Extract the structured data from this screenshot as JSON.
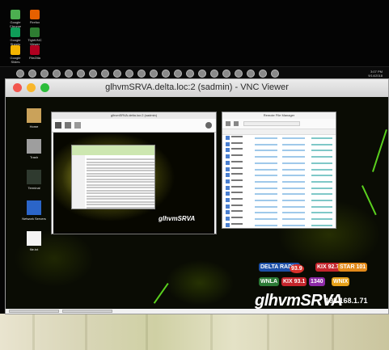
{
  "host": {
    "desktop_icons": [
      {
        "label": "Google Chrome",
        "color": "#4caf50"
      },
      {
        "label": "Firefox",
        "color": "#e66000"
      },
      {
        "label": "Google Sheets",
        "color": "#0f9d58"
      },
      {
        "label": "TightVNC Viewer",
        "color": "#2e7d32"
      },
      {
        "label": "Google Slides",
        "color": "#f4b400"
      },
      {
        "label": "FileZilla",
        "color": "#b00020"
      }
    ],
    "taskbar": {
      "item_count": 22,
      "clock": {
        "time": "3:07 PM",
        "date": "9/14/2018"
      }
    }
  },
  "vnc": {
    "title": "glhvmSRVA.delta.loc:2 (sadmin) - VNC Viewer",
    "traffic_colors": {
      "close": "#f2564e",
      "minimize": "#f8b72c",
      "zoom": "#2cbd3a"
    }
  },
  "remote": {
    "desktop_icons": [
      {
        "label": "Home",
        "color": "#caa25a"
      },
      {
        "label": "Trash",
        "color": "#9e9e9e"
      },
      {
        "label": "Terminal",
        "color": "#2f3a2f"
      },
      {
        "label": "Network Servers",
        "color": "#2b65c8"
      },
      {
        "label": "file.txt",
        "color": "#f4f4f4"
      }
    ],
    "logo": {
      "hostname": "glhvmSRVA",
      "ip": "192.168.1.71",
      "stations": [
        "DELTA RADIO",
        "93.9",
        "KIX 92.7",
        "STAR 101",
        "WNLA",
        "KIX 93.1",
        "1340",
        "WNIX"
      ]
    },
    "inner_vnc": {
      "title": "glhvmSRVA.delta.loc:2 (sadmin)",
      "nested_logo": "glhvmSRVA"
    },
    "explorer": {
      "title": "Remote File Manager",
      "row_count": 15
    }
  }
}
